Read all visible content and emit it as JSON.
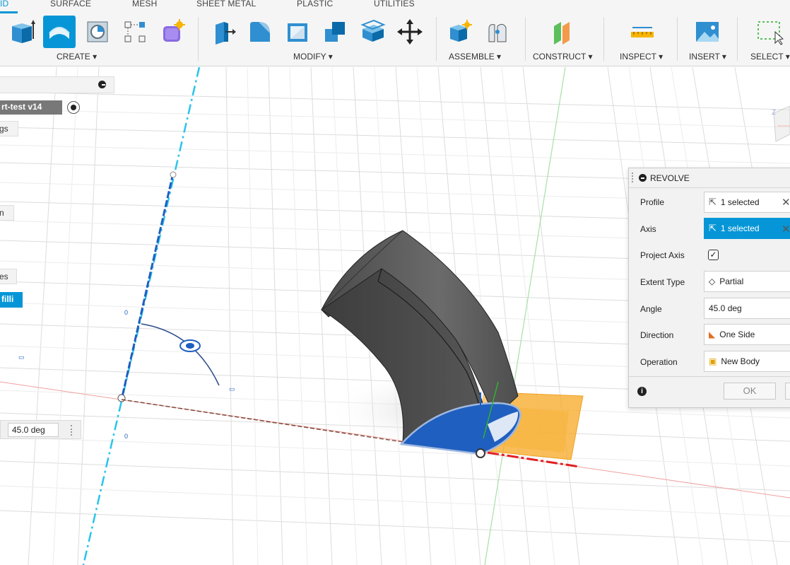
{
  "toolbar": {
    "tabs": [
      "ID",
      "SURFACE",
      "MESH",
      "SHEET METAL",
      "PLASTIC",
      "UTILITIES"
    ],
    "groups": {
      "create": "CREATE ▾",
      "modify": "MODIFY ▾",
      "assemble": "ASSEMBLE ▾",
      "construct": "CONSTRUCT ▾",
      "inspect": "INSPECT ▾",
      "insert": "INSERT ▾",
      "select": "SELECT ▾"
    }
  },
  "browser": {
    "doc_name": "rt-test v14",
    "items": [
      "gs",
      "n",
      "es",
      "filli"
    ]
  },
  "angle_input": "45.0 deg",
  "revolve": {
    "title": "REVOLVE",
    "rows": [
      {
        "label": "Profile",
        "value": "1 selected"
      },
      {
        "label": "Axis",
        "value": "1 selected"
      },
      {
        "label": "Project Axis",
        "value": ""
      },
      {
        "label": "Extent Type",
        "value": "Partial"
      },
      {
        "label": "Angle",
        "value": "45.0 deg"
      },
      {
        "label": "Direction",
        "value": "One Side"
      },
      {
        "label": "Operation",
        "value": "New Body"
      }
    ],
    "ok_label": "OK"
  },
  "colors": {
    "accent": "#0696d7",
    "body": "#5a5a5a",
    "preview": "#f7a823",
    "profile": "#1f5fbf"
  }
}
